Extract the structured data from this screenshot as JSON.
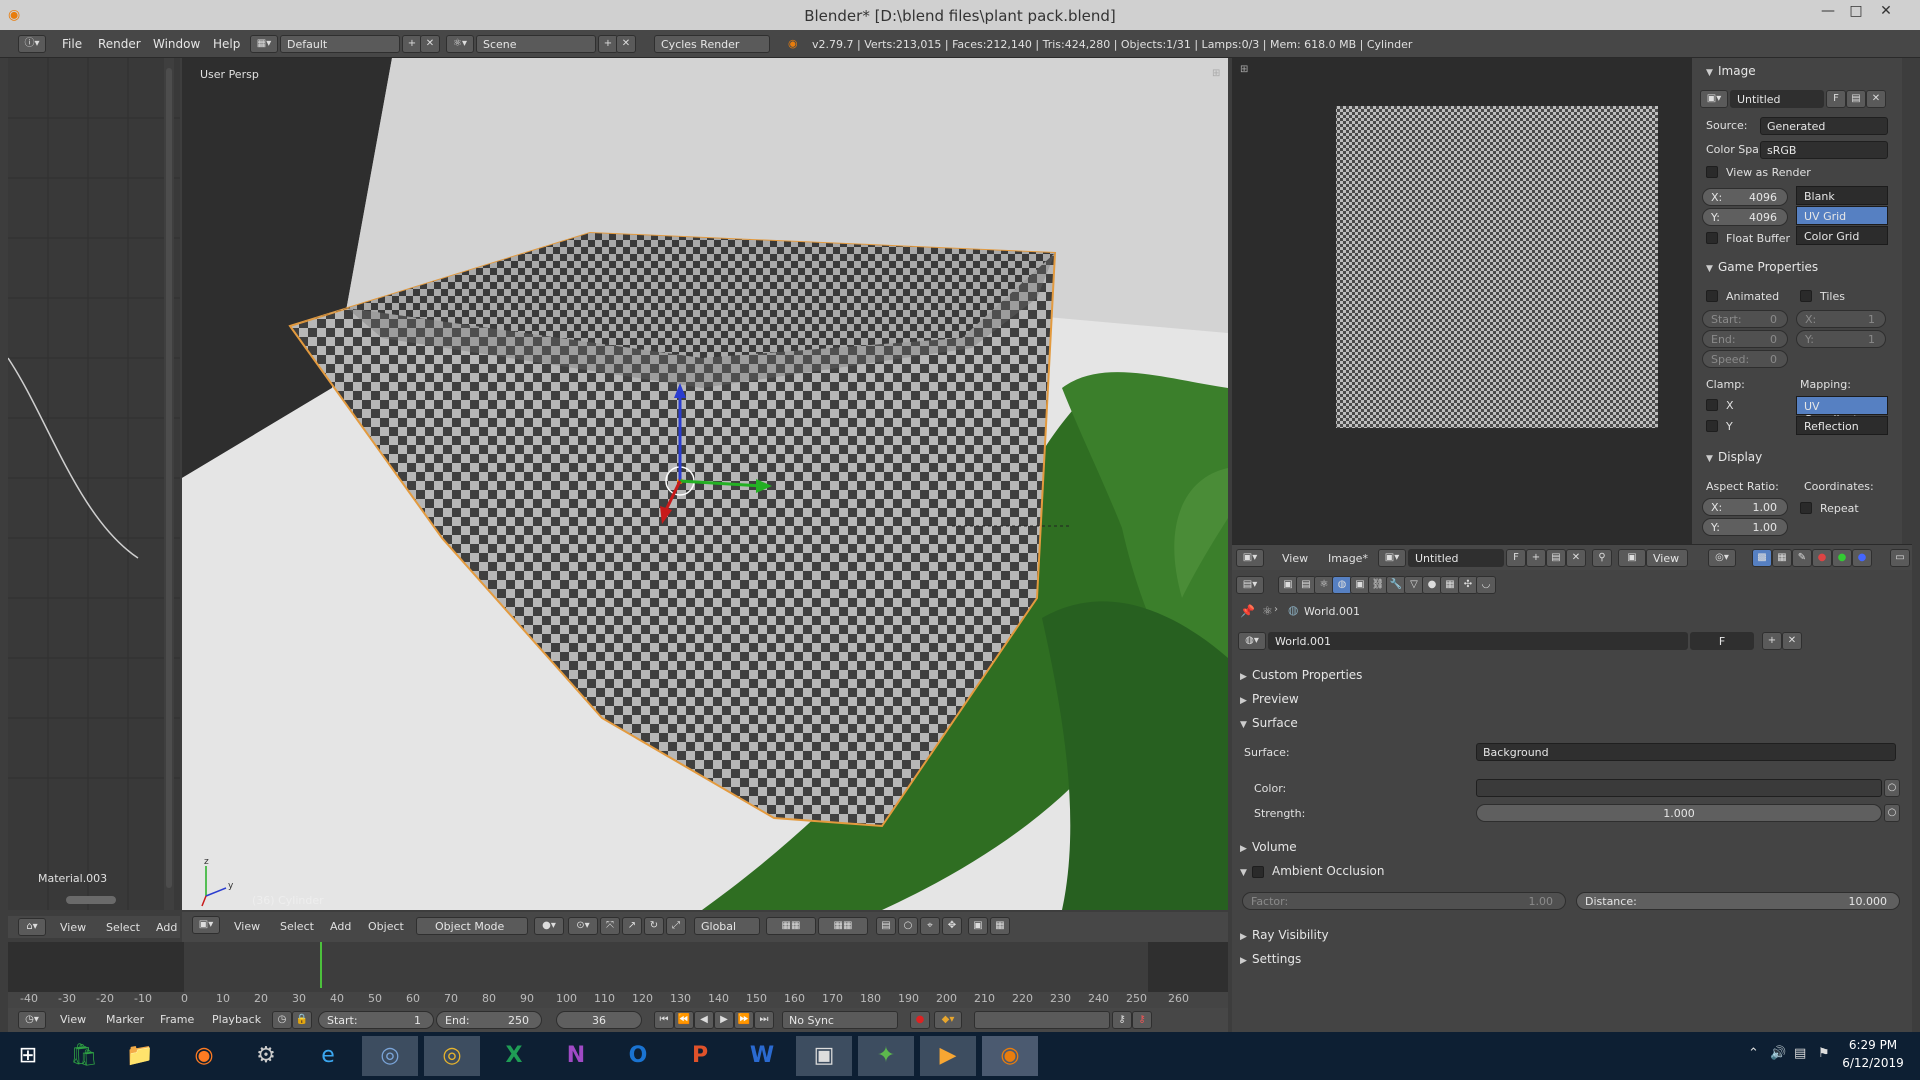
{
  "window": {
    "title": "Blender* [D:\\blend files\\plant pack.blend]",
    "minimize": "—",
    "maximize": "□",
    "close": "✕"
  },
  "info_header": {
    "menus": [
      "File",
      "Render",
      "Window",
      "Help"
    ],
    "layout": "Default",
    "scene": "Scene",
    "engine": "Cycles Render",
    "stats": "v2.79.7 | Verts:213,015 | Faces:212,140 | Tris:424,280 | Objects:1/31 | Lamps:0/3 | Mem: 618.0 MB | Cylinder"
  },
  "left_panel": {
    "material": "Material.003",
    "menus": [
      "View",
      "Select",
      "Add"
    ]
  },
  "viewport": {
    "label": "User Persp",
    "object_label": "(36) Cylinder",
    "menus": [
      "View",
      "Select",
      "Add",
      "Object"
    ],
    "mode": "Object Mode",
    "orientation": "Global"
  },
  "image_props": {
    "image_header": "Image",
    "image_name": "Untitled",
    "image_f": "F",
    "source_label": "Source:",
    "source_value": "Generated",
    "colorspace_label": "Color Spa...",
    "colorspace_value": "sRGB",
    "view_as_render": "View as Render",
    "x_label": "X:",
    "x_value": "4096",
    "y_label": "Y:",
    "y_value": "4096",
    "float_buffer": "Float Buffer",
    "gen_types": [
      "Blank",
      "UV Grid",
      "Color Grid"
    ],
    "gen_selected": "UV Grid",
    "game_header": "Game Properties",
    "animated": "Animated",
    "tiles": "Tiles",
    "start_label": "Start:",
    "start_value": "0",
    "end_label": "End:",
    "end_value": "0",
    "speed_label": "Speed:",
    "speed_value": "0",
    "tx_label": "X:",
    "tx_value": "1",
    "ty_label": "Y:",
    "ty_value": "1",
    "clamp_label": "Clamp:",
    "mapping_label": "Mapping:",
    "clamp_x": "X",
    "clamp_y": "Y",
    "mapping_options": [
      "UV Coordinates",
      "Reflection"
    ],
    "mapping_selected": "UV Coordinates",
    "display_header": "Display",
    "aspect_label": "Aspect Ratio:",
    "coords_label": "Coordinates:",
    "ax_label": "X:",
    "ax_value": "1.00",
    "ay_label": "Y:",
    "ay_value": "1.00",
    "repeat": "Repeat"
  },
  "image_editor_header": {
    "menus": [
      "View",
      "Image*"
    ],
    "image_name": "Untitled",
    "f": "F",
    "view": "View"
  },
  "world_props": {
    "breadcrumb": "World.001",
    "world_name": "World.001",
    "f": "F",
    "sections": {
      "custom_properties": "Custom Properties",
      "preview": "Preview",
      "surface": "Surface",
      "volume": "Volume",
      "ambient_occlusion": "Ambient Occlusion",
      "ray_visibility": "Ray Visibility",
      "settings": "Settings"
    },
    "surface_label": "Surface:",
    "surface_value": "Background",
    "color_label": "Color:",
    "strength_label": "Strength:",
    "strength_value": "1.000",
    "factor_label": "Factor:",
    "factor_value": "1.00",
    "distance_label": "Distance:",
    "distance_value": "10.000"
  },
  "timeline": {
    "ticks": [
      "-40",
      "-30",
      "-20",
      "-10",
      "0",
      "10",
      "20",
      "30",
      "40",
      "50",
      "60",
      "70",
      "80",
      "90",
      "100",
      "110",
      "120",
      "130",
      "140",
      "150",
      "160",
      "170",
      "180",
      "190",
      "200",
      "210",
      "220",
      "230",
      "240",
      "250",
      "260"
    ],
    "menus": [
      "View",
      "Marker",
      "Frame",
      "Playback"
    ],
    "start_label": "Start:",
    "start_value": "1",
    "end_label": "End:",
    "end_value": "250",
    "current_frame": "36",
    "sync": "No Sync"
  },
  "taskbar": {
    "time": "6:29 PM",
    "date": "6/12/2019"
  },
  "colors": {
    "accent_orange": "#e87d0d",
    "selection_blue": "#5680c2",
    "panel_bg": "#444444"
  }
}
